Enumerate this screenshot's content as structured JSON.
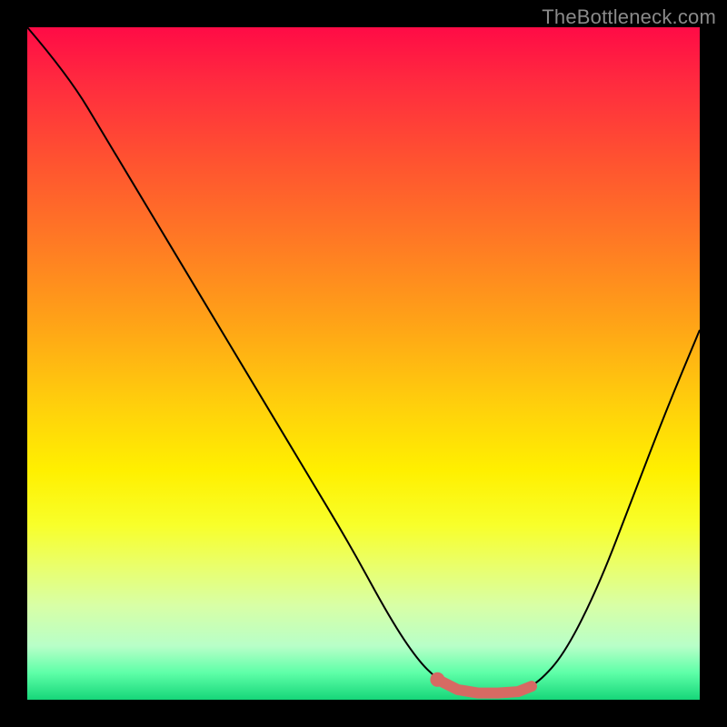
{
  "watermark": "TheBottleneck.com",
  "colors": {
    "gradient_top": "#ff0b46",
    "gradient_bottom": "#16d679",
    "curve": "#000000",
    "highlight": "#d66a63",
    "frame": "#000000"
  },
  "chart_data": {
    "type": "line",
    "title": "",
    "xlabel": "",
    "ylabel": "",
    "xlim": [
      0,
      100
    ],
    "ylim": [
      0,
      100
    ],
    "grid": false,
    "legend": false,
    "note": "Axes are unlabeled; values are normalized 0–100. y represents distance from optimal (0 = best, 100 = worst). Highlight marks the near-zero (optimal) region of the curve.",
    "series": [
      {
        "name": "curve",
        "x": [
          0,
          6,
          12,
          18,
          24,
          30,
          36,
          42,
          48,
          54,
          58,
          61,
          64,
          67,
          70,
          73,
          76,
          80,
          85,
          90,
          95,
          100
        ],
        "y": [
          100,
          93,
          83,
          73,
          63,
          53,
          43,
          33,
          23,
          12,
          6,
          3,
          1.5,
          1,
          1,
          1.2,
          2.5,
          7,
          17,
          30,
          43,
          55
        ]
      },
      {
        "name": "optimal_region_highlight",
        "x": [
          61,
          64,
          67,
          70,
          73,
          75
        ],
        "y": [
          3,
          1.5,
          1,
          1,
          1.2,
          2
        ]
      }
    ],
    "annotations": [
      {
        "type": "dot",
        "x": 61,
        "y": 3
      }
    ]
  }
}
